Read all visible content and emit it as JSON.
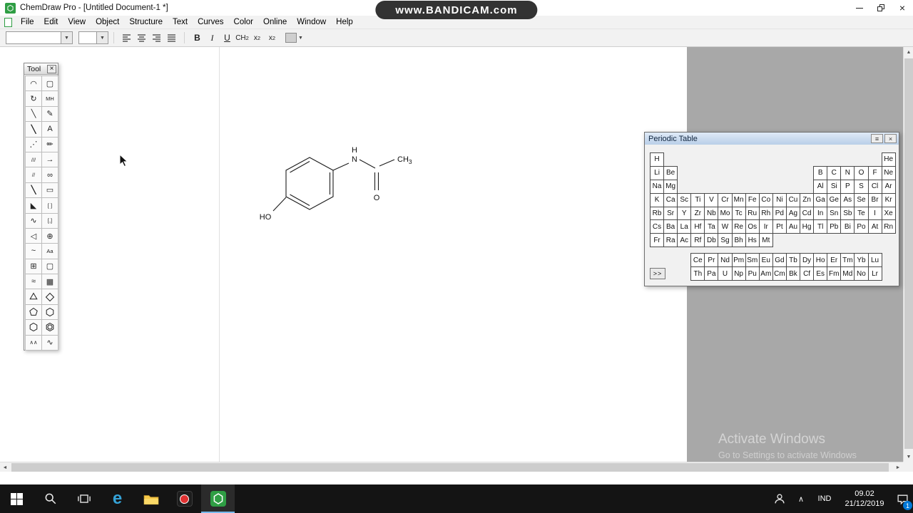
{
  "window": {
    "title": "ChemDraw Pro - [Untitled Document-1 *]"
  },
  "bandicam_watermark": "www.BANDICAM.com",
  "menu_bar": {
    "items": [
      "File",
      "Edit",
      "View",
      "Object",
      "Structure",
      "Text",
      "Curves",
      "Color",
      "Online",
      "Window",
      "Help"
    ]
  },
  "toolbar": {
    "bold": "B",
    "italic": "I",
    "underline": "U",
    "formula_main": "CH",
    "formula_sub": "2",
    "subscript_main": "x",
    "subscript_sub": "2",
    "superscript_main": "x",
    "superscript_sup": "2"
  },
  "tool_palette": {
    "title": "Tool",
    "tools": [
      {
        "name": "lasso-tool",
        "glyph": "◠"
      },
      {
        "name": "marquee-tool",
        "glyph": "▢"
      },
      {
        "name": "orbit-rotate-tool",
        "glyph": "↻"
      },
      {
        "name": "stereo-flip-tool",
        "glyph": "MH",
        "small": true
      },
      {
        "name": "solid-bond-tool",
        "glyph": "╲"
      },
      {
        "name": "eraser-tool",
        "glyph": "✎"
      },
      {
        "name": "multiple-bond-tool",
        "glyph": "╲",
        "bold": true
      },
      {
        "name": "text-tool",
        "glyph": "A"
      },
      {
        "name": "dashed-bond-tool",
        "glyph": "⋰"
      },
      {
        "name": "pencil-tool",
        "glyph": "✏"
      },
      {
        "name": "hashed-bond-tool",
        "glyph": "///",
        "small": true
      },
      {
        "name": "arrow-tool",
        "glyph": "→"
      },
      {
        "name": "hashed-wedge-bond-tool",
        "glyph": "//",
        "small": true
      },
      {
        "name": "orbital-tool",
        "glyph": "∞"
      },
      {
        "name": "bold-bond-tool",
        "glyph": "╲",
        "bold": true
      },
      {
        "name": "drawing-elements-tool",
        "glyph": "▭"
      },
      {
        "name": "wedge-bond-tool",
        "glyph": "◣"
      },
      {
        "name": "bracket-tool",
        "glyph": "[ ]",
        "small": true
      },
      {
        "name": "wavy-bond-tool",
        "glyph": "∿"
      },
      {
        "name": "bracket-pair-tool",
        "glyph": "[,]",
        "small": true
      },
      {
        "name": "hollow-wedge-bond-tool",
        "glyph": "◁"
      },
      {
        "name": "chemical-symbols-tool",
        "glyph": "⊕"
      },
      {
        "name": "curve-tool",
        "glyph": "~"
      },
      {
        "name": "atom-label-tool",
        "glyph": "Aa",
        "small": true
      },
      {
        "name": "table-tool",
        "glyph": "⊞"
      },
      {
        "name": "template-marquee-tool",
        "glyph": "▢"
      },
      {
        "name": "chain-tool",
        "glyph": "≈"
      },
      {
        "name": "templates-tool",
        "glyph": "▦"
      },
      {
        "name": "cyclopropane-tool",
        "ngon": 3
      },
      {
        "name": "cyclobutane-tool",
        "ngon": 4
      },
      {
        "name": "cyclopentane-tool",
        "ngon": 5
      },
      {
        "name": "cyclohexane-tool",
        "ngon": 6
      },
      {
        "name": "cyclohexane-alt-tool",
        "ngon": 6
      },
      {
        "name": "benzene-tool",
        "ngon": 6,
        "circle": true
      },
      {
        "name": "acyclic-chain-tool",
        "glyph": "∧∧",
        "small": true
      },
      {
        "name": "wavy-chain-tool",
        "glyph": "∿"
      }
    ]
  },
  "periodic_table": {
    "title": "Periodic Table",
    "more_button": ">>",
    "periods": [
      [
        [
          "H",
          1
        ],
        [
          "He",
          18
        ]
      ],
      [
        [
          "Li",
          1
        ],
        [
          "Be",
          2
        ],
        [
          "B",
          13
        ],
        [
          "C",
          14
        ],
        [
          "N",
          15
        ],
        [
          "O",
          16
        ],
        [
          "F",
          17
        ],
        [
          "Ne",
          18
        ]
      ],
      [
        [
          "Na",
          1
        ],
        [
          "Mg",
          2
        ],
        [
          "Al",
          13
        ],
        [
          "Si",
          14
        ],
        [
          "P",
          15
        ],
        [
          "S",
          16
        ],
        [
          "Cl",
          17
        ],
        [
          "Ar",
          18
        ]
      ],
      [
        [
          "K",
          1
        ],
        [
          "Ca",
          2
        ],
        [
          "Sc",
          3
        ],
        [
          "Ti",
          4
        ],
        [
          "V",
          5
        ],
        [
          "Cr",
          6
        ],
        [
          "Mn",
          7
        ],
        [
          "Fe",
          8
        ],
        [
          "Co",
          9
        ],
        [
          "Ni",
          10
        ],
        [
          "Cu",
          11
        ],
        [
          "Zn",
          12
        ],
        [
          "Ga",
          13
        ],
        [
          "Ge",
          14
        ],
        [
          "As",
          15
        ],
        [
          "Se",
          16
        ],
        [
          "Br",
          17
        ],
        [
          "Kr",
          18
        ]
      ],
      [
        [
          "Rb",
          1
        ],
        [
          "Sr",
          2
        ],
        [
          "Y",
          3
        ],
        [
          "Zr",
          4
        ],
        [
          "Nb",
          5
        ],
        [
          "Mo",
          6
        ],
        [
          "Tc",
          7
        ],
        [
          "Ru",
          8
        ],
        [
          "Rh",
          9
        ],
        [
          "Pd",
          10
        ],
        [
          "Ag",
          11
        ],
        [
          "Cd",
          12
        ],
        [
          "In",
          13
        ],
        [
          "Sn",
          14
        ],
        [
          "Sb",
          15
        ],
        [
          "Te",
          16
        ],
        [
          "I",
          17
        ],
        [
          "Xe",
          18
        ]
      ],
      [
        [
          "Cs",
          1
        ],
        [
          "Ba",
          2
        ],
        [
          "La",
          3
        ],
        [
          "Hf",
          4
        ],
        [
          "Ta",
          5
        ],
        [
          "W",
          6
        ],
        [
          "Re",
          7
        ],
        [
          "Os",
          8
        ],
        [
          "Ir",
          9
        ],
        [
          "Pt",
          10
        ],
        [
          "Au",
          11
        ],
        [
          "Hg",
          12
        ],
        [
          "Tl",
          13
        ],
        [
          "Pb",
          14
        ],
        [
          "Bi",
          15
        ],
        [
          "Po",
          16
        ],
        [
          "At",
          17
        ],
        [
          "Rn",
          18
        ]
      ],
      [
        [
          "Fr",
          1
        ],
        [
          "Ra",
          2
        ],
        [
          "Ac",
          3
        ],
        [
          "Rf",
          4
        ],
        [
          "Db",
          5
        ],
        [
          "Sg",
          6
        ],
        [
          "Bh",
          7
        ],
        [
          "Hs",
          8
        ],
        [
          "Mt",
          9
        ]
      ]
    ],
    "lanthanides": [
      "Ce",
      "Pr",
      "Nd",
      "Pm",
      "Sm",
      "Eu",
      "Gd",
      "Tb",
      "Dy",
      "Ho",
      "Er",
      "Tm",
      "Yb",
      "Lu"
    ],
    "actinides": [
      "Th",
      "Pa",
      "U",
      "Np",
      "Pu",
      "Am",
      "Cm",
      "Bk",
      "Cf",
      "Es",
      "Fm",
      "Md",
      "No",
      "Lr"
    ]
  },
  "structure": {
    "atoms": {
      "h": "H",
      "n": "N",
      "ch_main": "CH",
      "ch_sub": "3",
      "o": "O",
      "ho": "HO"
    }
  },
  "activate_watermark": {
    "line1": "Activate Windows",
    "line2": "Go to Settings to activate Windows"
  },
  "taskbar": {
    "language": "IND",
    "time": "09.02",
    "date": "21/12/2019",
    "notification_badge": "1",
    "edge_letter": "e"
  },
  "icons": {
    "close": "×",
    "menu": "≡",
    "combo_arrow": "▼",
    "chevron": "∧",
    "scroll_left": "◄",
    "scroll_right": "►",
    "scroll_up": "▲",
    "scroll_down": "▼"
  },
  "colors": {
    "accent": "#0078d7",
    "taskbar_bg": "#141414",
    "workspace_gray": "#a8a8a8",
    "edge_blue": "#35a3d8",
    "chemdraw_green": "#2f9e44",
    "record_red": "#e03131",
    "folder_yellow": "#f7c948",
    "pt_titlebar": "#b9cfe8",
    "pt_titlebar_light": "#dfeaf7"
  }
}
